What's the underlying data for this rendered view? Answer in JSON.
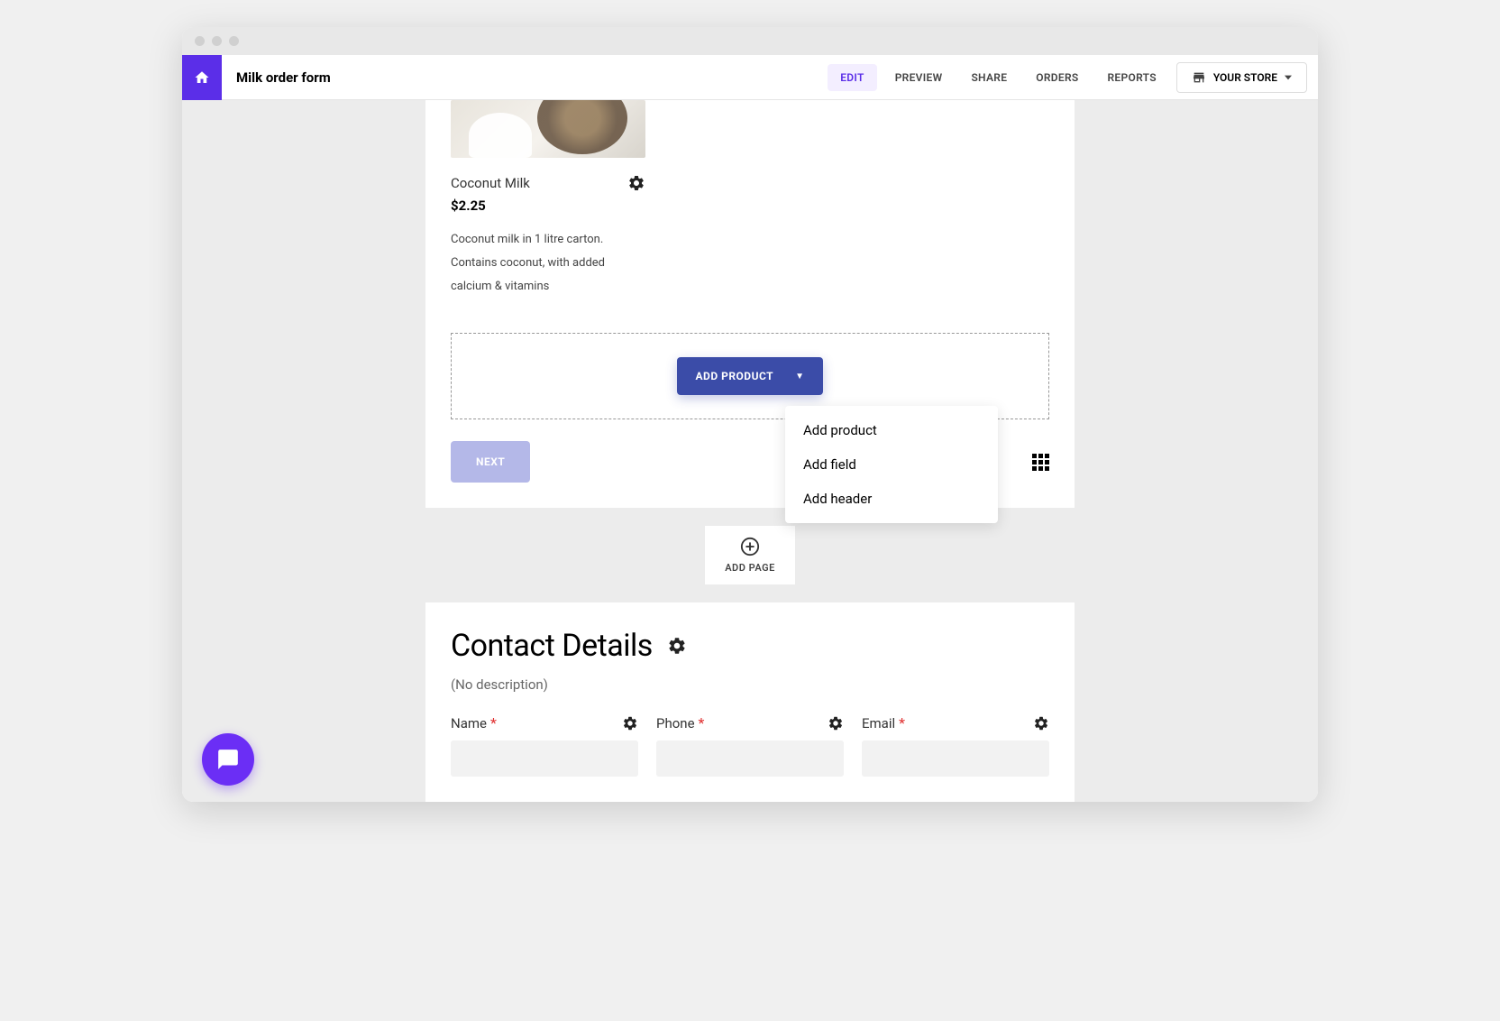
{
  "header": {
    "title": "Milk order form",
    "tabs": [
      "EDIT",
      "PREVIEW",
      "SHARE",
      "ORDERS",
      "REPORTS"
    ],
    "active_tab": "EDIT",
    "store_label": "YOUR STORE"
  },
  "product": {
    "name": "Coconut Milk",
    "price": "$2.25",
    "description": "Coconut milk in 1 litre carton. Contains coconut, with added calcium & vitamins"
  },
  "add_product": {
    "button_label": "ADD PRODUCT",
    "menu": [
      "Add product",
      "Add field",
      "Add header"
    ]
  },
  "next_label": "NEXT",
  "add_page_label": "ADD PAGE",
  "contact": {
    "title": "Contact Details",
    "no_description": "(No description)",
    "fields": [
      {
        "label": "Name",
        "required": true
      },
      {
        "label": "Phone",
        "required": true
      },
      {
        "label": "Email",
        "required": true
      }
    ]
  }
}
